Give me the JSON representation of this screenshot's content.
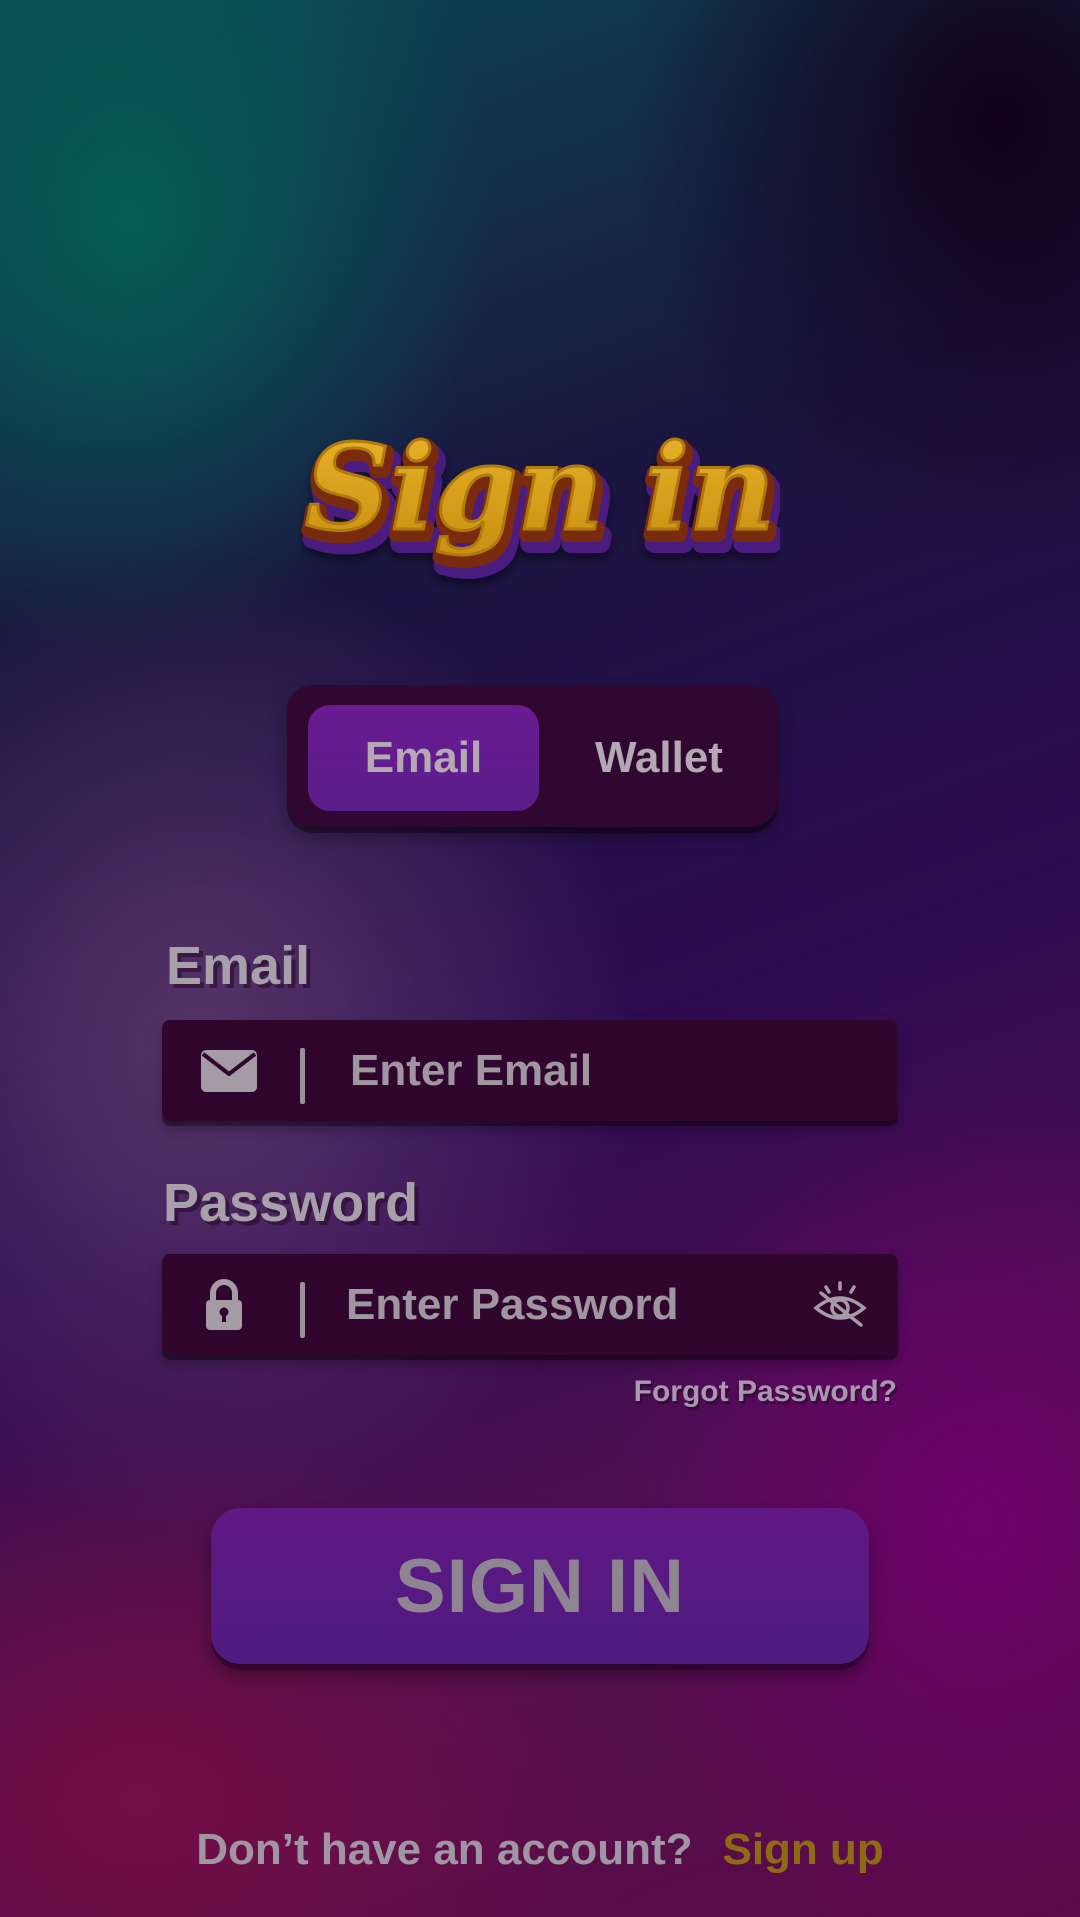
{
  "header": {
    "title": "Sign in"
  },
  "tabs": {
    "email_label": "Email",
    "wallet_label": "Wallet",
    "active": "Email"
  },
  "form": {
    "email_label": "Email",
    "email_placeholder": "Enter Email",
    "email_value": "",
    "password_label": "Password",
    "password_placeholder": "Enter Password",
    "password_value": "",
    "forgot_label": "Forgot Password?"
  },
  "actions": {
    "signin_label": "SIGN IN"
  },
  "footer": {
    "prompt": "Don’t have an account?",
    "signup_label": "Sign up"
  },
  "icons": {
    "email_field_icon": "envelope-icon",
    "password_field_icon": "lock-icon",
    "password_toggle_icon": "eye-slash-icon"
  },
  "colors": {
    "title_fill": "#e0a51a",
    "active_tab": "#6b1a92",
    "field_background": "#30062f",
    "signup_link": "#8c6b12"
  }
}
